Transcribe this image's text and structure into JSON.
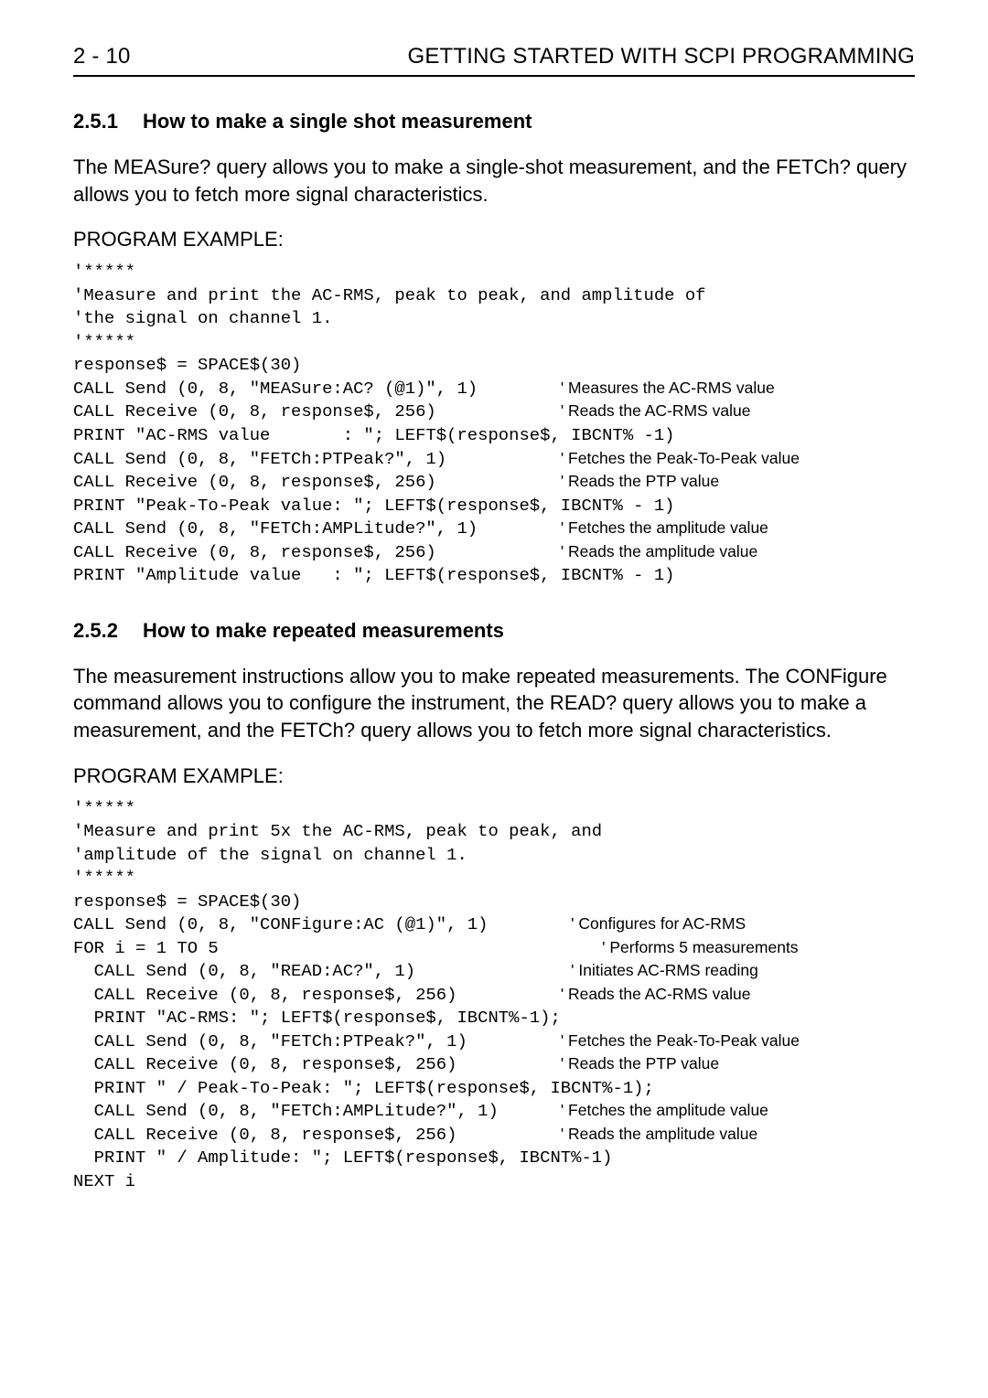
{
  "header": {
    "page_num": "2 - 10",
    "title": "GETTING STARTED WITH SCPI PROGRAMMING"
  },
  "section1": {
    "num": "2.5.1",
    "title": "How to make a single shot measurement",
    "body": "The MEASure? query allows you to make a single-shot measurement, and the FETCh? query allows you to fetch more signal characteristics.",
    "program_heading": "PROGRAM EXAMPLE:",
    "code": {
      "l1": "'*****",
      "l2": "'Measure and print the AC-RMS, peak to peak, and amplitude of",
      "l3": "'the signal on channel 1.",
      "l4": "'*****",
      "l5": "response$ = SPACE$(30)",
      "l6": "CALL Send (0, 8, \"MEASure:AC? (@1)\", 1)",
      "c6": "' Measures the AC-RMS value",
      "l7": "CALL Receive (0, 8, response$, 256)",
      "c7": "' Reads the AC-RMS value",
      "l8": "PRINT \"AC-RMS value       : \"; LEFT$(response$, IBCNT% -1)",
      "l9": "CALL Send (0, 8, \"FETCh:PTPeak?\", 1)",
      "c9": "' Fetches the Peak-To-Peak value",
      "l10": "CALL Receive (0, 8, response$, 256)",
      "c10": "' Reads the PTP value",
      "l11": "PRINT \"Peak-To-Peak value: \"; LEFT$(response$, IBCNT% - 1)",
      "l12": "CALL Send (0, 8, \"FETCh:AMPLitude?\", 1)",
      "c12": "' Fetches the amplitude value",
      "l13": "CALL Receive (0, 8, response$, 256)",
      "c13": "' Reads the amplitude value",
      "l14": "PRINT \"Amplitude value   : \"; LEFT$(response$, IBCNT% - 1)"
    }
  },
  "section2": {
    "num": "2.5.2",
    "title": "How to make repeated measurements",
    "body": "The measurement instructions allow you to make repeated measurements. The CONFigure command allows you to configure the instrument, the READ? query allows you to make a measurement, and the FETCh? query allows you to fetch more signal characteristics.",
    "program_heading": "PROGRAM EXAMPLE:",
    "code": {
      "l1": "'*****",
      "l2": "'Measure and print 5x the AC-RMS, peak to peak, and",
      "l3": "'amplitude of the signal on channel 1.",
      "l4": "'*****",
      "l5": "response$ = SPACE$(30)",
      "l6": "CALL Send (0, 8, \"CONFigure:AC (@1)\", 1)",
      "c6": "' Configures for AC-RMS",
      "l7": "FOR i = 1 TO 5",
      "c7": "' Performs 5 measurements",
      "l8": "  CALL Send (0, 8, \"READ:AC?\", 1)",
      "c8": "' Initiates AC-RMS reading",
      "l9": "  CALL Receive (0, 8, response$, 256)",
      "c9": "' Reads the AC-RMS value",
      "l10": "  PRINT \"AC-RMS: \"; LEFT$(response$, IBCNT%-1);",
      "l11": "  CALL Send (0, 8, \"FETCh:PTPeak?\", 1)",
      "c11": "' Fetches the Peak-To-Peak value",
      "l12": "  CALL Receive (0, 8, response$, 256)",
      "c12": "' Reads the PTP value",
      "l13": "  PRINT \" / Peak-To-Peak: \"; LEFT$(response$, IBCNT%-1);",
      "l14": "  CALL Send (0, 8, \"FETCh:AMPLitude?\", 1)",
      "c14": "' Fetches the amplitude value",
      "l15": "  CALL Receive (0, 8, response$, 256)",
      "c15": "' Reads the amplitude value",
      "l16": "  PRINT \" / Amplitude: \"; LEFT$(response$, IBCNT%-1)",
      "l17": "NEXT i"
    }
  }
}
